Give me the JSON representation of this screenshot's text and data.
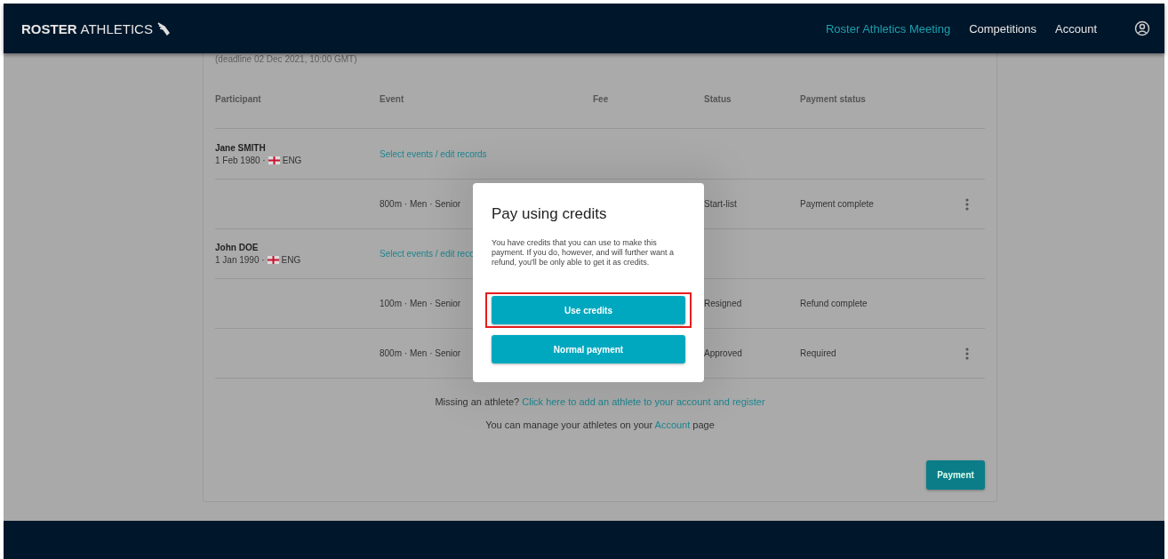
{
  "header": {
    "logo_bold": "ROSTER",
    "logo_light": "ATHLETICS",
    "nav": [
      {
        "label": "Roster Athletics Meeting",
        "selected": true
      },
      {
        "label": "Competitions",
        "selected": false
      },
      {
        "label": "Account",
        "selected": false
      }
    ]
  },
  "deadline": "(deadline 02 Dec 2021, 10:00 GMT)",
  "table": {
    "columns": [
      "Participant",
      "Event",
      "Fee",
      "Status",
      "Payment status"
    ],
    "rows": [
      {
        "kind": "athlete",
        "name": "Jane SMITH",
        "born": "1 Feb 1980 ·",
        "country": "ENG",
        "link": "Select events / edit records"
      },
      {
        "kind": "entry",
        "event": "800m · Men · Senior",
        "status": "Start-list",
        "payment": "Payment complete",
        "menu": true
      },
      {
        "kind": "athlete",
        "name": "John DOE",
        "born": "1 Jan 1990 ·",
        "country": "ENG",
        "link": "Select events / edit reco"
      },
      {
        "kind": "entry",
        "event": "100m · Men · Senior",
        "status": "Resigned",
        "payment": "Refund complete",
        "menu": false
      },
      {
        "kind": "entry",
        "event": "800m · Men · Senior",
        "status": "Approved",
        "payment": "Required",
        "menu": true
      }
    ]
  },
  "missing": {
    "text": "Missing an athlete?",
    "link": "Click here to add an athlete to your account and register"
  },
  "manage": {
    "before": "You can manage your athletes on your",
    "link": "Account",
    "after": "page"
  },
  "payment_button": "Payment",
  "dialog": {
    "title": "Pay using credits",
    "body": "You have credits that you can use to make this payment. If you do, however, and will further want a refund, you'll be only able to get it as credits.",
    "buttons": [
      {
        "label": "Use credits",
        "highlighted": true
      },
      {
        "label": "Normal payment",
        "highlighted": false
      }
    ]
  }
}
